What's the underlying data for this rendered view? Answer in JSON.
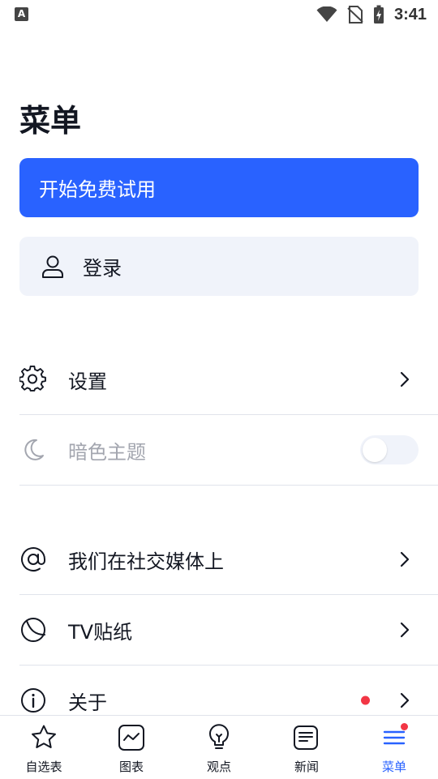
{
  "status_bar": {
    "notification_icon": "A",
    "time": "3:41",
    "icons": [
      "wifi-icon",
      "no-sim-icon",
      "battery-charging-icon"
    ]
  },
  "page": {
    "title": "菜单"
  },
  "buttons": {
    "trial": "开始免费试用",
    "login": "登录"
  },
  "menu": {
    "settings": "设置",
    "dark_theme": "暗色主题",
    "social": "我们在社交媒体上",
    "tv_stickers": "TV贴纸",
    "about": "关于"
  },
  "bottom_nav": {
    "items": [
      {
        "label": "自选表",
        "icon": "star-icon"
      },
      {
        "label": "图表",
        "icon": "chart-icon"
      },
      {
        "label": "观点",
        "icon": "lightbulb-icon"
      },
      {
        "label": "新闻",
        "icon": "news-icon"
      },
      {
        "label": "菜单",
        "icon": "menu-icon",
        "active": true
      }
    ]
  },
  "colors": {
    "accent": "#2962ff",
    "alert": "#f23645",
    "muted": "#a3a6af",
    "surface": "#f0f3fa"
  }
}
